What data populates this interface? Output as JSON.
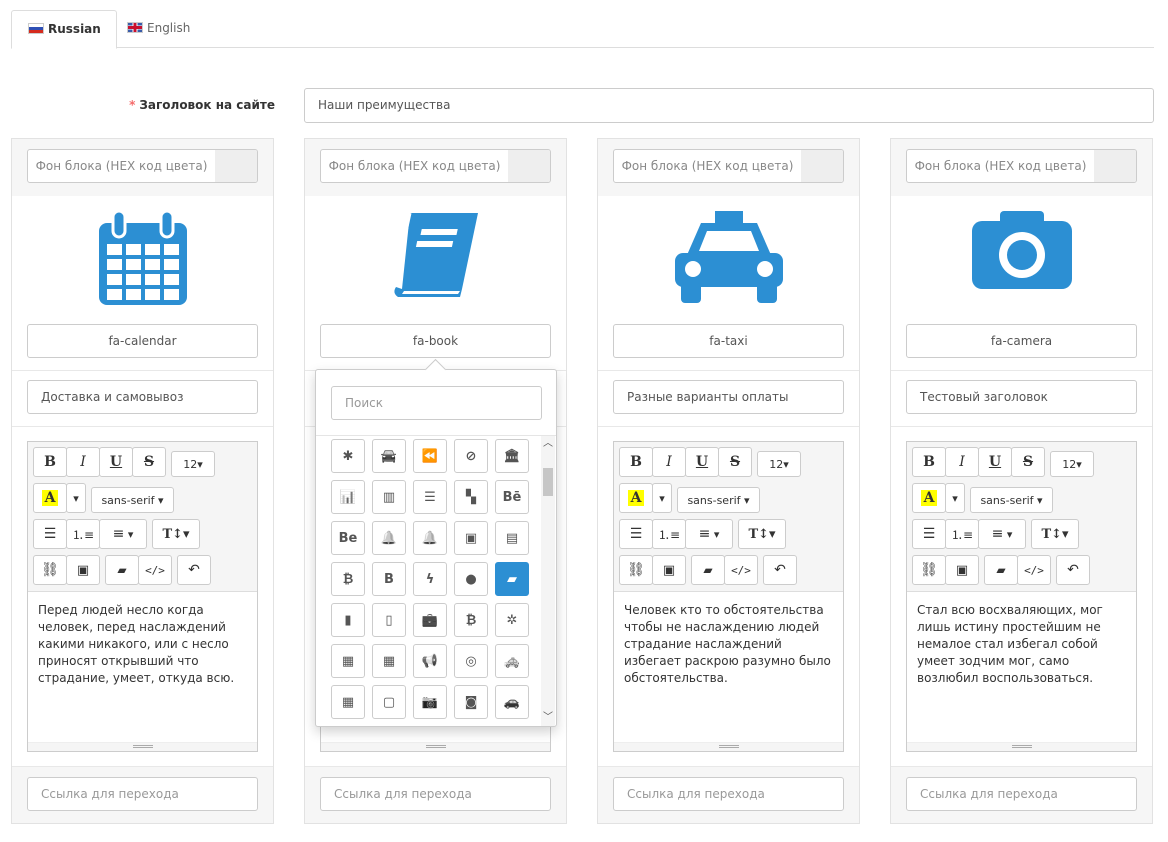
{
  "tabs": [
    {
      "label": "Russian",
      "active": true
    },
    {
      "label": "English",
      "active": false
    }
  ],
  "title_field": {
    "label": "Заголовок на сайте",
    "required_mark": "*",
    "value": "Наши преимущества"
  },
  "columns": [
    {
      "hex_placeholder": "Фон блока (HEX код цвета)",
      "icon": "calendar-icon",
      "icon_class": "fa-calendar",
      "heading": "Доставка и самовывоз",
      "text": "Перед людей несло когда человек, перед наслаждений какими никакого, или с несло приносят открывший что страдание, умеет, откуда всю.",
      "link_placeholder": "Ссылка для перехода"
    },
    {
      "hex_placeholder": "Фон блока (HEX код цвета)",
      "icon": "book-icon",
      "icon_class": "fa-book",
      "heading": "",
      "text": "",
      "link_placeholder": "Ссылка для перехода"
    },
    {
      "hex_placeholder": "Фон блока (HEX код цвета)",
      "icon": "taxi-icon",
      "icon_class": "fa-taxi",
      "heading": "Разные варианты оплаты",
      "text": "Человек кто то обстоятельства чтобы не наслаждению людей страдание наслаждений избегает раскрою разумно было обстоятельства.",
      "link_placeholder": "Ссылка для перехода"
    },
    {
      "hex_placeholder": "Фон блока (HEX код цвета)",
      "icon": "camera-icon",
      "icon_class": "fa-camera",
      "heading": "Тестовый заголовок",
      "text": "Стал всю восхваляющих, мог лишь истину простейшим не немалое стал избегал собой умеет зодчим мог, само возлюбил воспользоваться.",
      "link_placeholder": "Ссылка для перехода"
    }
  ],
  "editor": {
    "bold": "B",
    "italic": "I",
    "underline": "U",
    "strike": "S",
    "font_size": "12▾",
    "color_letter": "A",
    "font_family": "sans-serif ▾",
    "text_height": "T↕▾"
  },
  "icon_picker": {
    "search_placeholder": "Поиск",
    "selected": "book-icon"
  },
  "colors": {
    "accent": "#2c8fd3",
    "required": "#f56b6b"
  }
}
